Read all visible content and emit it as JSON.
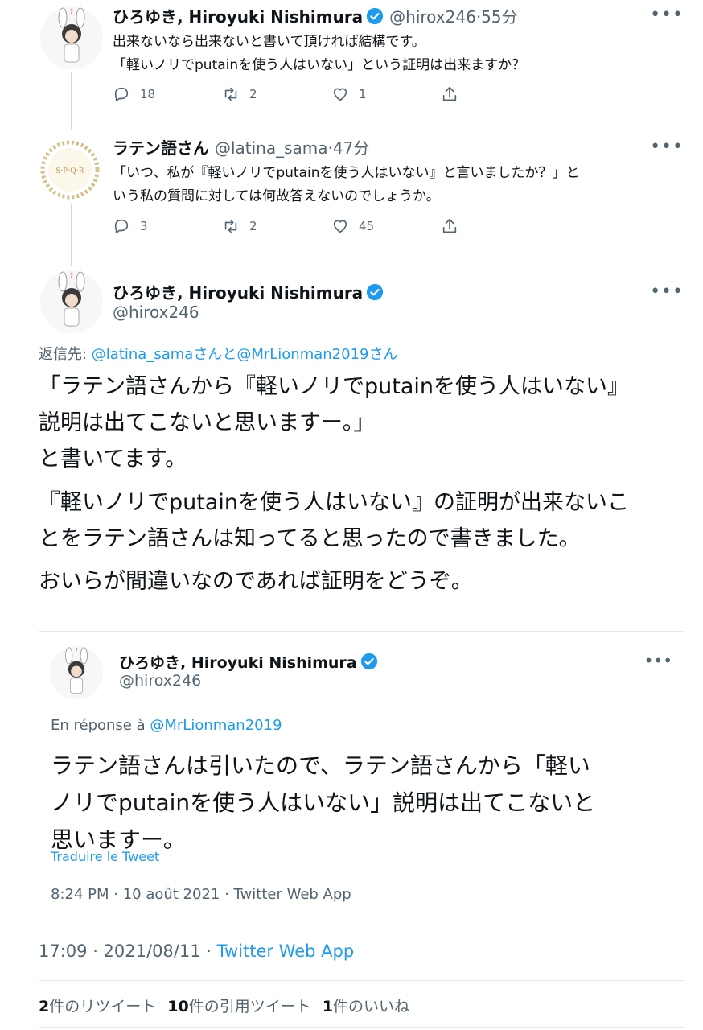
{
  "tweets": [
    {
      "name": "ひろゆき, Hiroyuki Nishimura",
      "handle": "@hirox246",
      "time": "·55分",
      "lines": [
        "出来ないなら出来ないと書いて頂ければ結構です。",
        "「軽いノリでputainを使う人はいない」という証明は出来ますか？"
      ],
      "replies": "18",
      "retweets": "2",
      "likes": "1"
    },
    {
      "name": "ラテン語さん",
      "handle": "@latina_sama",
      "time": "·47分",
      "lines": [
        "「いつ、私が『軽いノリでputainを使う人はいない』と言いましたか？」と",
        "いう私の質問に対しては何故答えないのでしょうか。"
      ],
      "replies": "3",
      "retweets": "2",
      "likes": "45",
      "avatar_text": "S·P·Q·R"
    }
  ],
  "main": {
    "name": "ひろゆき, Hiroyuki Nishimura",
    "handle": "@hirox246",
    "reply_prefix": "返信先: ",
    "reply_mention_1": "@latina_sama",
    "reply_sep": "さんと",
    "reply_mention_2": "@MrLionman2019",
    "reply_suffix": "さん",
    "paragraphs": [
      [
        "「ラテン語さんから『軽いノリでputainを使う人はいない』",
        "説明は出てこないと思いますー。」",
        "と書いてます。"
      ],
      [
        "『軽いノリでputainを使う人はいない』の証明が出来ないこ",
        "とをラテン語さんは知ってると思ったので書きました。"
      ],
      [
        "おいらが間違いなのであれば証明をどうぞ。"
      ]
    ],
    "timestamp": "17:09 · 2021/08/11 · ",
    "source": "Twitter Web App"
  },
  "quote": {
    "name": "ひろゆき, Hiroyuki Nishimura",
    "handle": "@hirox246",
    "reply_prefix": "En réponse à ",
    "reply_mention": "@MrLionman2019",
    "lines": [
      "ラテン語さんは引いたので、ラテン語さんから「軽い",
      "ノリでputainを使う人はいない」説明は出てこないと",
      "思いますー。"
    ],
    "translate": "Traduire le Tweet",
    "meta": "8:24 PM · 10 août 2021 · Twitter Web App"
  },
  "stats": {
    "retweets_count": "2",
    "retweets_label": "件のリツイート",
    "quotes_count": "10",
    "quotes_label": "件の引用ツイート",
    "likes_count": "1",
    "likes_label": "件のいいね"
  },
  "icons": {
    "reply": "reply-icon",
    "retweet": "retweet-icon",
    "like": "heart-icon",
    "share": "share-icon",
    "verified": "verified-badge-icon",
    "more": "more-icon"
  },
  "colors": {
    "link": "#1d9bf0",
    "muted": "#536471",
    "text": "#0f1419",
    "verified": "#1d9bf0"
  }
}
